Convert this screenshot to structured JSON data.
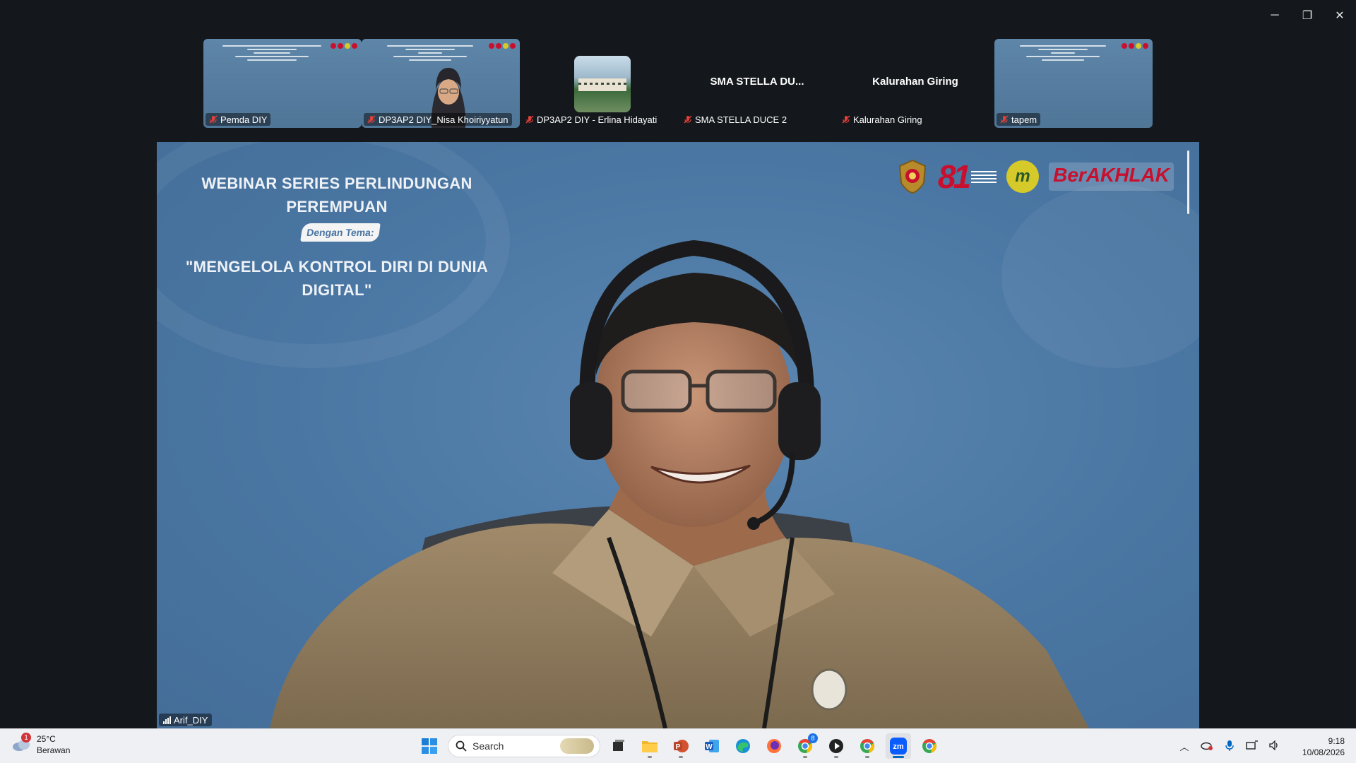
{
  "window": {
    "minimize": "─",
    "restore": "❐",
    "close": "✕"
  },
  "thumbnails": [
    {
      "name": "Pemda DIY",
      "type": "slide",
      "muted": true
    },
    {
      "name": "DP3AP2 DIY_Nisa Khoiriyyatun",
      "type": "slide-with-person",
      "muted": true
    },
    {
      "name": "DP3AP2 DIY - Erlina Hidayati",
      "type": "avatar-photo",
      "muted": true
    },
    {
      "name": "SMA STELLA DUCE 2",
      "display_name": "SMA  STELLA  DU...",
      "type": "name-only",
      "muted": true
    },
    {
      "name": "Kalurahan Giring",
      "display_name": "Kalurahan Giring",
      "type": "name-only",
      "muted": true
    },
    {
      "name": "tapem",
      "type": "slide",
      "muted": true
    }
  ],
  "main_video": {
    "slide_title": "WEBINAR SERIES PERLINDUNGAN PEREMPUAN",
    "slide_subtitle": "Dengan Tema:",
    "slide_topic": "\"MENGELOLA KONTROL DIRI DI DUNIA DIGITAL\"",
    "logo_81": "81",
    "logo_m": "m",
    "logo_berakhlak": "BerAKHLAK",
    "speaker": "Arif_DIY",
    "colors": {
      "slide_bg": "#4a76a3",
      "accent_red": "#c8102e",
      "logo_yellow": "#d6c92a"
    }
  },
  "taskbar": {
    "weather": {
      "temp": "25°C",
      "condition": "Berawan",
      "badge": "1"
    },
    "search": {
      "label": "Search"
    },
    "pinned": [
      {
        "name": "windows-start",
        "icon": "windows-logo-icon"
      },
      {
        "name": "task-view",
        "icon": "task-view-icon"
      },
      {
        "name": "file-explorer",
        "icon": "folder-icon"
      },
      {
        "name": "powerpoint",
        "icon": "powerpoint-icon"
      },
      {
        "name": "word",
        "icon": "word-icon"
      },
      {
        "name": "edge",
        "icon": "edge-icon"
      },
      {
        "name": "firefox",
        "icon": "firefox-icon"
      },
      {
        "name": "chrome-profile",
        "icon": "chrome-icon",
        "badge": "8"
      },
      {
        "name": "media-player",
        "icon": "play-icon"
      },
      {
        "name": "chrome",
        "icon": "chrome-icon"
      },
      {
        "name": "zoom",
        "icon": "zoom-icon",
        "label": "zm",
        "active": true
      },
      {
        "name": "chrome-2",
        "icon": "chrome-icon"
      }
    ],
    "clock": {
      "time": "9:18",
      "date": "10/08/2026"
    }
  }
}
